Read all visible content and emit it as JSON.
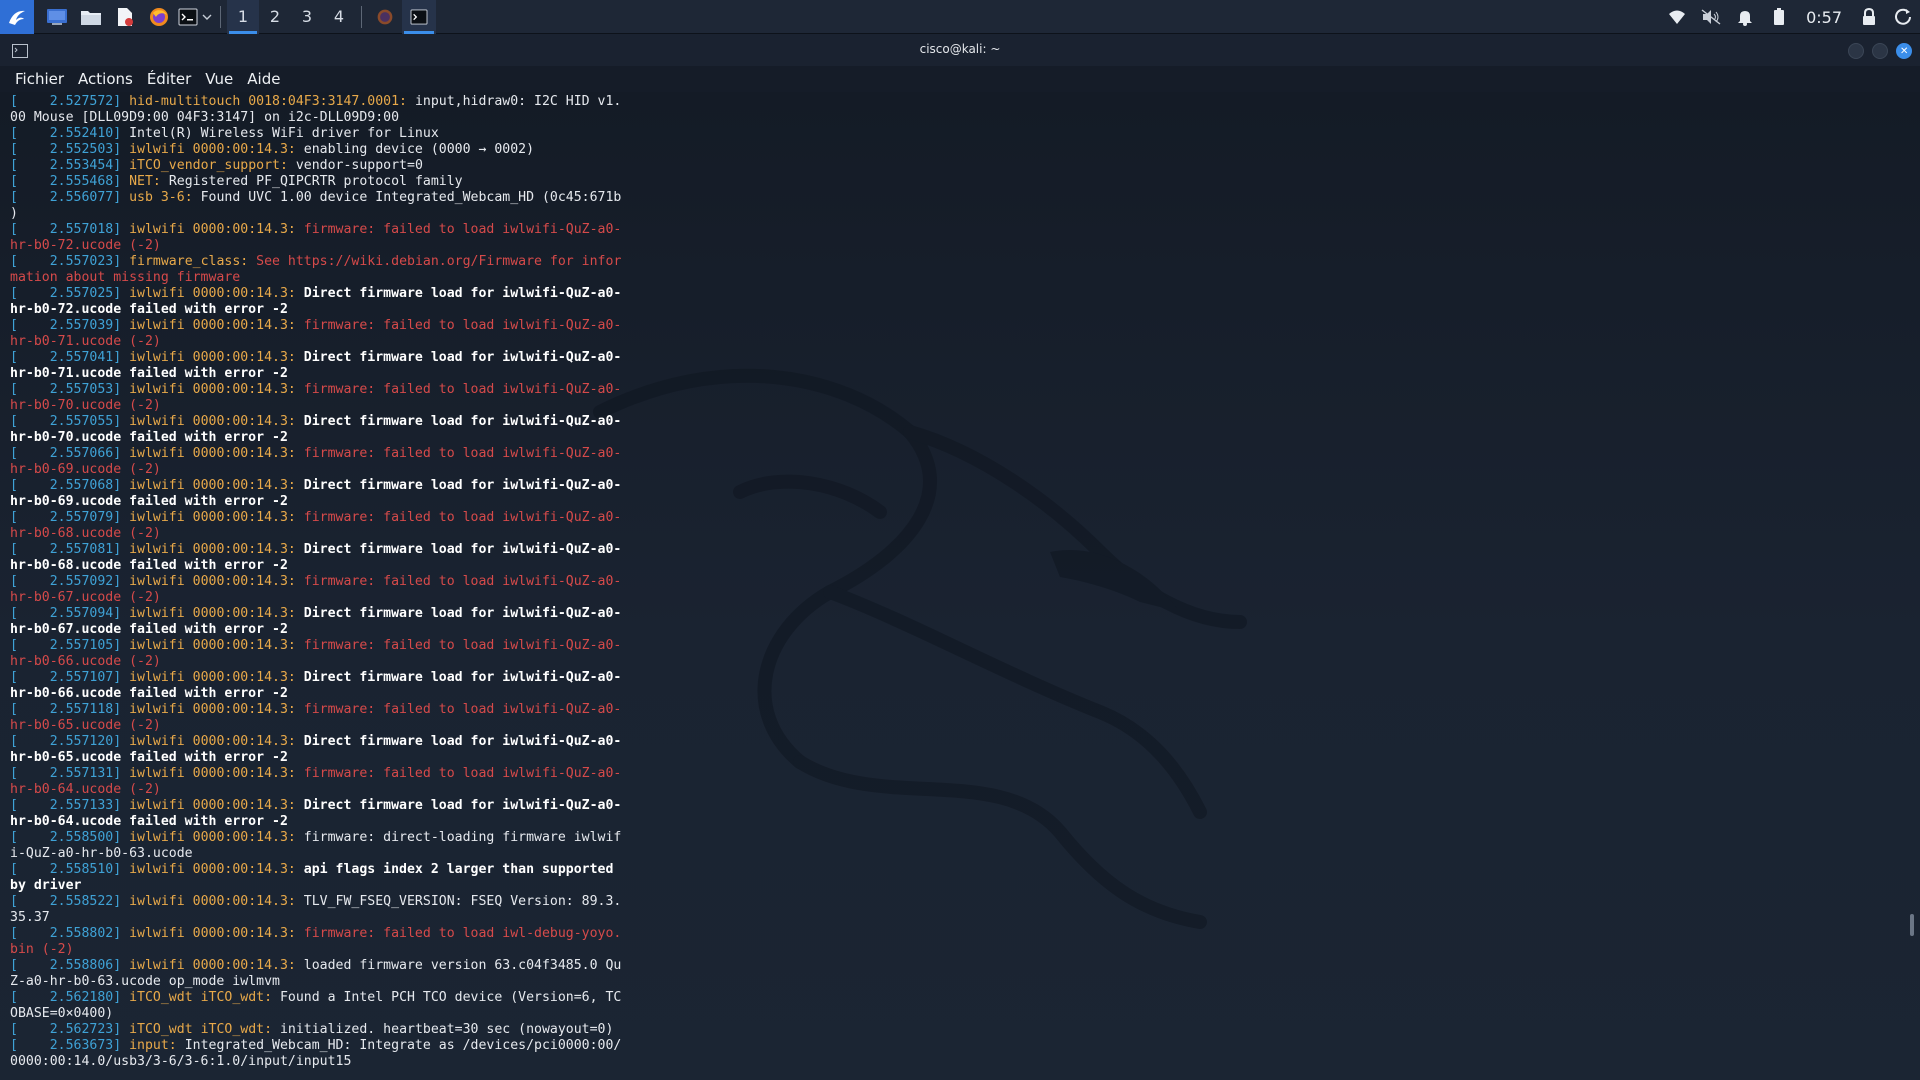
{
  "taskbar": {
    "workspaces": [
      "1",
      "2",
      "3",
      "4"
    ],
    "clock": "0:57",
    "accent": "#3b8eea"
  },
  "window": {
    "title": "cisco@kali: ~",
    "menu": [
      "Fichier",
      "Actions",
      "Éditer",
      "Vue",
      "Aide"
    ]
  },
  "terminal": {
    "lines": [
      [
        [
          "c-br",
          "[    "
        ],
        [
          "c-ts",
          "2.527572]"
        ],
        [
          "c-dev",
          " hid-multitouch 0018:04F3:3147.0001:"
        ],
        [
          "c-w",
          " input,hidraw0: I2C HID v1."
        ]
      ],
      [
        [
          "c-w",
          "00 Mouse [DLL09D9:00 04F3:3147] on i2c-DLL09D9:00"
        ]
      ],
      [
        [
          "c-br",
          "[    "
        ],
        [
          "c-ts",
          "2.552410]"
        ],
        [
          "c-w",
          " Intel(R) Wireless WiFi driver for Linux"
        ]
      ],
      [
        [
          "c-br",
          "[    "
        ],
        [
          "c-ts",
          "2.552503]"
        ],
        [
          "c-dev",
          " iwlwifi 0000:00:14.3:"
        ],
        [
          "c-w",
          " enabling device (0000 → 0002)"
        ]
      ],
      [
        [
          "c-br",
          "[    "
        ],
        [
          "c-ts",
          "2.553454]"
        ],
        [
          "c-dev",
          " iTCO_vendor_support:"
        ],
        [
          "c-w",
          " vendor-support=0"
        ]
      ],
      [
        [
          "c-br",
          "[    "
        ],
        [
          "c-ts",
          "2.555468]"
        ],
        [
          "c-dev",
          " NET:"
        ],
        [
          "c-w",
          " Registered PF_QIPCRTR protocol family"
        ]
      ],
      [
        [
          "c-br",
          "[    "
        ],
        [
          "c-ts",
          "2.556077]"
        ],
        [
          "c-dev",
          " usb 3-6:"
        ],
        [
          "c-w",
          " Found UVC 1.00 device Integrated_Webcam_HD (0c45:671b"
        ]
      ],
      [
        [
          "c-w",
          ")"
        ]
      ],
      [
        [
          "c-br",
          "[    "
        ],
        [
          "c-ts",
          "2.557018]"
        ],
        [
          "c-dev",
          " iwlwifi 0000:00:14.3:"
        ],
        [
          "c-err",
          " firmware: failed to load iwlwifi-QuZ-a0-"
        ]
      ],
      [
        [
          "c-err",
          "hr-b0-72.ucode (-2)"
        ]
      ],
      [
        [
          "c-br",
          "[    "
        ],
        [
          "c-ts",
          "2.557023]"
        ],
        [
          "c-dev",
          " firmware_class:"
        ],
        [
          "c-err",
          " See https://wiki.debian.org/Firmware for infor"
        ]
      ],
      [
        [
          "c-err",
          "mation about missing firmware"
        ]
      ],
      [
        [
          "c-br",
          "[    "
        ],
        [
          "c-ts",
          "2.557025]"
        ],
        [
          "c-dev",
          " iwlwifi 0000:00:14.3:"
        ],
        [
          "c-b",
          " Direct firmware load for iwlwifi-QuZ-a0-"
        ]
      ],
      [
        [
          "c-b",
          "hr-b0-72.ucode failed with error -2"
        ]
      ],
      [
        [
          "c-br",
          "[    "
        ],
        [
          "c-ts",
          "2.557039]"
        ],
        [
          "c-dev",
          " iwlwifi 0000:00:14.3:"
        ],
        [
          "c-err",
          " firmware: failed to load iwlwifi-QuZ-a0-"
        ]
      ],
      [
        [
          "c-err",
          "hr-b0-71.ucode (-2)"
        ]
      ],
      [
        [
          "c-br",
          "[    "
        ],
        [
          "c-ts",
          "2.557041]"
        ],
        [
          "c-dev",
          " iwlwifi 0000:00:14.3:"
        ],
        [
          "c-b",
          " Direct firmware load for iwlwifi-QuZ-a0-"
        ]
      ],
      [
        [
          "c-b",
          "hr-b0-71.ucode failed with error -2"
        ]
      ],
      [
        [
          "c-br",
          "[    "
        ],
        [
          "c-ts",
          "2.557053]"
        ],
        [
          "c-dev",
          " iwlwifi 0000:00:14.3:"
        ],
        [
          "c-err",
          " firmware: failed to load iwlwifi-QuZ-a0-"
        ]
      ],
      [
        [
          "c-err",
          "hr-b0-70.ucode (-2)"
        ]
      ],
      [
        [
          "c-br",
          "[    "
        ],
        [
          "c-ts",
          "2.557055]"
        ],
        [
          "c-dev",
          " iwlwifi 0000:00:14.3:"
        ],
        [
          "c-b",
          " Direct firmware load for iwlwifi-QuZ-a0-"
        ]
      ],
      [
        [
          "c-b",
          "hr-b0-70.ucode failed with error -2"
        ]
      ],
      [
        [
          "c-br",
          "[    "
        ],
        [
          "c-ts",
          "2.557066]"
        ],
        [
          "c-dev",
          " iwlwifi 0000:00:14.3:"
        ],
        [
          "c-err",
          " firmware: failed to load iwlwifi-QuZ-a0-"
        ]
      ],
      [
        [
          "c-err",
          "hr-b0-69.ucode (-2)"
        ]
      ],
      [
        [
          "c-br",
          "[    "
        ],
        [
          "c-ts",
          "2.557068]"
        ],
        [
          "c-dev",
          " iwlwifi 0000:00:14.3:"
        ],
        [
          "c-b",
          " Direct firmware load for iwlwifi-QuZ-a0-"
        ]
      ],
      [
        [
          "c-b",
          "hr-b0-69.ucode failed with error -2"
        ]
      ],
      [
        [
          "c-br",
          "[    "
        ],
        [
          "c-ts",
          "2.557079]"
        ],
        [
          "c-dev",
          " iwlwifi 0000:00:14.3:"
        ],
        [
          "c-err",
          " firmware: failed to load iwlwifi-QuZ-a0-"
        ]
      ],
      [
        [
          "c-err",
          "hr-b0-68.ucode (-2)"
        ]
      ],
      [
        [
          "c-br",
          "[    "
        ],
        [
          "c-ts",
          "2.557081]"
        ],
        [
          "c-dev",
          " iwlwifi 0000:00:14.3:"
        ],
        [
          "c-b",
          " Direct firmware load for iwlwifi-QuZ-a0-"
        ]
      ],
      [
        [
          "c-b",
          "hr-b0-68.ucode failed with error -2"
        ]
      ],
      [
        [
          "c-br",
          "[    "
        ],
        [
          "c-ts",
          "2.557092]"
        ],
        [
          "c-dev",
          " iwlwifi 0000:00:14.3:"
        ],
        [
          "c-err",
          " firmware: failed to load iwlwifi-QuZ-a0-"
        ]
      ],
      [
        [
          "c-err",
          "hr-b0-67.ucode (-2)"
        ]
      ],
      [
        [
          "c-br",
          "[    "
        ],
        [
          "c-ts",
          "2.557094]"
        ],
        [
          "c-dev",
          " iwlwifi 0000:00:14.3:"
        ],
        [
          "c-b",
          " Direct firmware load for iwlwifi-QuZ-a0-"
        ]
      ],
      [
        [
          "c-b",
          "hr-b0-67.ucode failed with error -2"
        ]
      ],
      [
        [
          "c-br",
          "[    "
        ],
        [
          "c-ts",
          "2.557105]"
        ],
        [
          "c-dev",
          " iwlwifi 0000:00:14.3:"
        ],
        [
          "c-err",
          " firmware: failed to load iwlwifi-QuZ-a0-"
        ]
      ],
      [
        [
          "c-err",
          "hr-b0-66.ucode (-2)"
        ]
      ],
      [
        [
          "c-br",
          "[    "
        ],
        [
          "c-ts",
          "2.557107]"
        ],
        [
          "c-dev",
          " iwlwifi 0000:00:14.3:"
        ],
        [
          "c-b",
          " Direct firmware load for iwlwifi-QuZ-a0-"
        ]
      ],
      [
        [
          "c-b",
          "hr-b0-66.ucode failed with error -2"
        ]
      ],
      [
        [
          "c-br",
          "[    "
        ],
        [
          "c-ts",
          "2.557118]"
        ],
        [
          "c-dev",
          " iwlwifi 0000:00:14.3:"
        ],
        [
          "c-err",
          " firmware: failed to load iwlwifi-QuZ-a0-"
        ]
      ],
      [
        [
          "c-err",
          "hr-b0-65.ucode (-2)"
        ]
      ],
      [
        [
          "c-br",
          "[    "
        ],
        [
          "c-ts",
          "2.557120]"
        ],
        [
          "c-dev",
          " iwlwifi 0000:00:14.3:"
        ],
        [
          "c-b",
          " Direct firmware load for iwlwifi-QuZ-a0-"
        ]
      ],
      [
        [
          "c-b",
          "hr-b0-65.ucode failed with error -2"
        ]
      ],
      [
        [
          "c-br",
          "[    "
        ],
        [
          "c-ts",
          "2.557131]"
        ],
        [
          "c-dev",
          " iwlwifi 0000:00:14.3:"
        ],
        [
          "c-err",
          " firmware: failed to load iwlwifi-QuZ-a0-"
        ]
      ],
      [
        [
          "c-err",
          "hr-b0-64.ucode (-2)"
        ]
      ],
      [
        [
          "c-br",
          "[    "
        ],
        [
          "c-ts",
          "2.557133]"
        ],
        [
          "c-dev",
          " iwlwifi 0000:00:14.3:"
        ],
        [
          "c-b",
          " Direct firmware load for iwlwifi-QuZ-a0-"
        ]
      ],
      [
        [
          "c-b",
          "hr-b0-64.ucode failed with error -2"
        ]
      ],
      [
        [
          "c-br",
          "[    "
        ],
        [
          "c-ts",
          "2.558500]"
        ],
        [
          "c-dev",
          " iwlwifi 0000:00:14.3:"
        ],
        [
          "c-w",
          " firmware: direct-loading firmware iwlwif"
        ]
      ],
      [
        [
          "c-w",
          "i-QuZ-a0-hr-b0-63.ucode"
        ]
      ],
      [
        [
          "c-br",
          "[    "
        ],
        [
          "c-ts",
          "2.558510]"
        ],
        [
          "c-dev",
          " iwlwifi 0000:00:14.3:"
        ],
        [
          "c-b",
          " api flags index 2 larger than supported"
        ]
      ],
      [
        [
          "c-b",
          "by driver"
        ]
      ],
      [
        [
          "c-br",
          "[    "
        ],
        [
          "c-ts",
          "2.558522]"
        ],
        [
          "c-dev",
          " iwlwifi 0000:00:14.3:"
        ],
        [
          "c-w",
          " TLV_FW_FSEQ_VERSION: FSEQ Version: 89.3."
        ]
      ],
      [
        [
          "c-w",
          "35.37"
        ]
      ],
      [
        [
          "c-br",
          "[    "
        ],
        [
          "c-ts",
          "2.558802]"
        ],
        [
          "c-dev",
          " iwlwifi 0000:00:14.3:"
        ],
        [
          "c-err",
          " firmware: failed to load iwl-debug-yoyo."
        ]
      ],
      [
        [
          "c-err",
          "bin (-2)"
        ]
      ],
      [
        [
          "c-br",
          "[    "
        ],
        [
          "c-ts",
          "2.558806]"
        ],
        [
          "c-dev",
          " iwlwifi 0000:00:14.3:"
        ],
        [
          "c-w",
          " loaded firmware version 63.c04f3485.0 Qu"
        ]
      ],
      [
        [
          "c-w",
          "Z-a0-hr-b0-63.ucode op_mode iwlmvm"
        ]
      ],
      [
        [
          "c-br",
          "[    "
        ],
        [
          "c-ts",
          "2.562180]"
        ],
        [
          "c-dev",
          " iTCO_wdt iTCO_wdt:"
        ],
        [
          "c-w",
          " Found a Intel PCH TCO device (Version=6, TC"
        ]
      ],
      [
        [
          "c-w",
          "OBASE=0×0400)"
        ]
      ],
      [
        [
          "c-br",
          "[    "
        ],
        [
          "c-ts",
          "2.562723]"
        ],
        [
          "c-dev",
          " iTCO_wdt iTCO_wdt:"
        ],
        [
          "c-w",
          " initialized. heartbeat=30 sec (nowayout=0)"
        ]
      ],
      [
        [
          "c-br",
          "[    "
        ],
        [
          "c-ts",
          "2.563673]"
        ],
        [
          "c-dev",
          " input:"
        ],
        [
          "c-w",
          " Integrated_Webcam_HD: Integrate as /devices/pci0000:00/"
        ]
      ],
      [
        [
          "c-w",
          "0000:00:14.0/usb3/3-6/3-6:1.0/input/input15"
        ]
      ]
    ]
  }
}
